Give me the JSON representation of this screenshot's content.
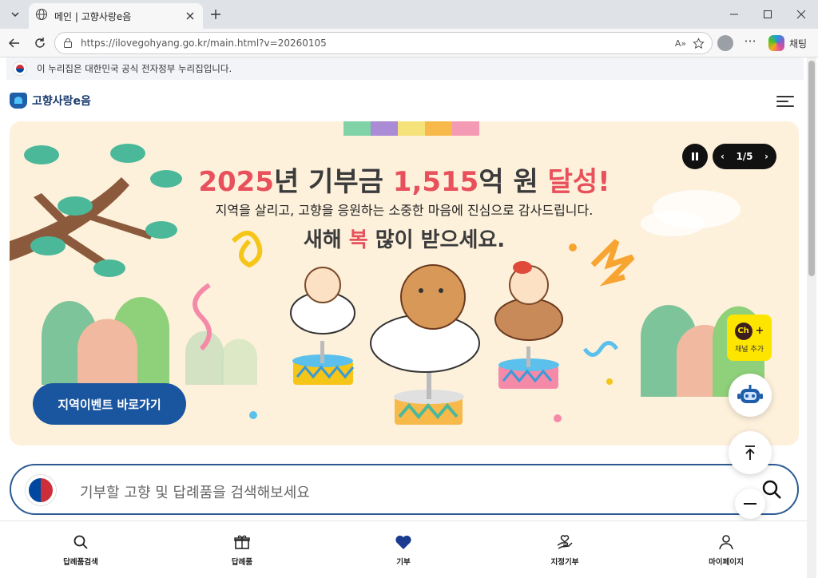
{
  "browser": {
    "tab_title": "메인 | 고향사랑e음",
    "url": "https://ilovegohyang.go.kr/main.html?v=20260105",
    "read_aloud_label": "A»",
    "chat_label": "채팅"
  },
  "gov_notice": {
    "text": "이 누리집은 대한민국 공식 전자정부 누리집입니다."
  },
  "header": {
    "logo_text": "고향사랑e음"
  },
  "banner": {
    "headline_pre": "2025",
    "headline_mid1": "년 기부금 ",
    "headline_amount": "1,515",
    "headline_mid2": "억 원 ",
    "headline_end": "달성!",
    "subline": "지역을 살리고, 고향을 응원하는 소중한 마음에 진심으로 감사드립니다.",
    "newyear_pre": "새해 ",
    "newyear_bok": "복",
    "newyear_post": " 많이 받으세요.",
    "pager": "1/5",
    "pager_prev": "‹",
    "pager_next": "›",
    "event_button": "지역이벤트 바로가기",
    "stripe_colors": [
      "#7fd3a6",
      "#a98bd6",
      "#f5e27a",
      "#f7b94a",
      "#f59ab4"
    ]
  },
  "search": {
    "placeholder": "기부할 고향 및 답례품을 검색해보세요"
  },
  "kakao": {
    "ch": "Ch",
    "plus": "+",
    "label": "채널 추가"
  },
  "bottom_nav": [
    {
      "label": "답례품검색",
      "icon": "search-icon"
    },
    {
      "label": "답례품",
      "icon": "gift-icon"
    },
    {
      "label": "기부",
      "icon": "heart-icon"
    },
    {
      "label": "지정기부",
      "icon": "hand-heart-icon"
    },
    {
      "label": "마이페이지",
      "icon": "user-icon"
    }
  ],
  "colors": {
    "brand_blue": "#1a55a0",
    "accent_red": "#e8505b",
    "banner_bg": "#fdf1dc"
  }
}
